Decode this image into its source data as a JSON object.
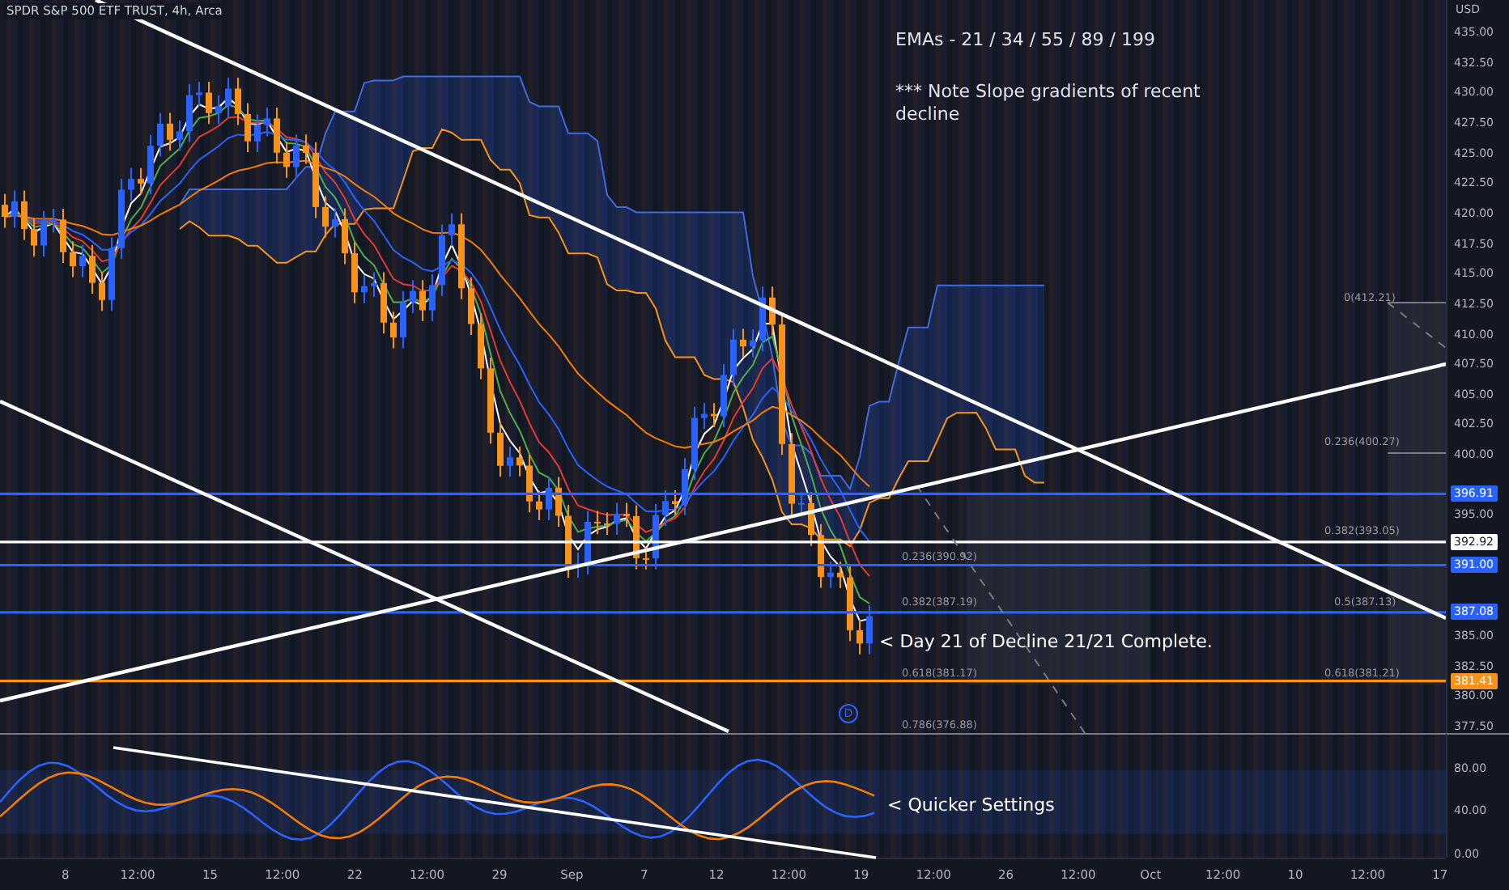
{
  "chart": {
    "title": "SPDR S&P 500 ETF TRUST, 4h, Arca",
    "annotations": [
      {
        "kind": "note",
        "text": "EMAs - 21 / 34 / 55 / 89 / 199"
      },
      {
        "kind": "note",
        "text": "*** Note Slope gradients of recent decline"
      },
      {
        "kind": "callout",
        "text": "< Day 21 of Decline 21/21 Complete."
      }
    ],
    "fib_labels": [
      "0(412.21)",
      "0.236(400.27)",
      "0.382(393.05)",
      "0.236(390.92)",
      "0.382(387.19)",
      "0.5(387.13)",
      "0.618(381.17)",
      "0.618(381.21)",
      "0.786(376.88)"
    ],
    "dividend_marker": "D"
  },
  "price_axis": {
    "currency": "USD",
    "ticks": [
      "435.00",
      "432.50",
      "430.00",
      "427.50",
      "425.00",
      "422.50",
      "420.00",
      "417.50",
      "415.00",
      "412.50",
      "410.00",
      "407.50",
      "405.00",
      "402.50",
      "400.00",
      "395.00",
      "385.00",
      "382.50",
      "380.00",
      "377.50"
    ],
    "price_labels": [
      {
        "text": "396.91",
        "color": "#2962ff"
      },
      {
        "text": "392.92",
        "color": "#ffffff"
      },
      {
        "text": "391.00",
        "color": "#2962ff"
      },
      {
        "text": "387.08",
        "color": "#2962ff"
      },
      {
        "text": "381.41",
        "color": "#f7931a"
      }
    ]
  },
  "oscillator": {
    "annotation": "< Quicker Settings",
    "ticks": [
      "80.00",
      "40.00",
      "0.00"
    ]
  },
  "time_axis": [
    "8",
    "12:00",
    "15",
    "12:00",
    "22",
    "12:00",
    "29",
    "Sep",
    "7",
    "12",
    "12:00",
    "19",
    "12:00",
    "26",
    "12:00",
    "Oct",
    "12:00",
    "10",
    "12:00",
    "17"
  ]
}
